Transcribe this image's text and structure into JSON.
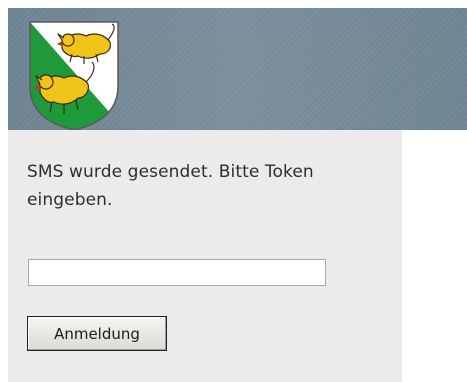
{
  "header": {
    "logo_icon": "thurgau-coat-of-arms-icon"
  },
  "login": {
    "message": "SMS wurde gesendet. Bitte Token eingeben.",
    "token_value": "",
    "token_placeholder": "",
    "submit_label": "Anmeldung"
  },
  "colors": {
    "header_blue_gray": "#6f8594",
    "panel_background": "#ecebea",
    "crest_green": "#1f9a3a",
    "crest_white": "#ffffff",
    "lion_gold": "#f0c419",
    "lion_tongue_red": "#d42a2a"
  }
}
